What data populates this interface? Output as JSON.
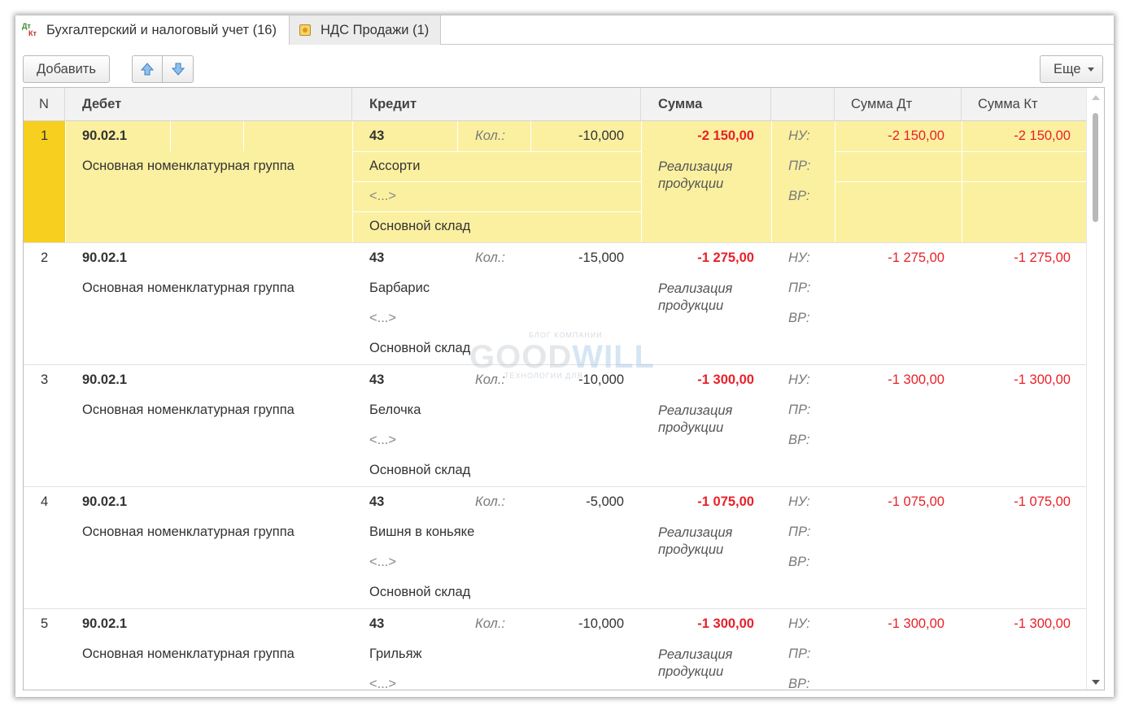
{
  "tabs": [
    {
      "label": "Бухгалтерский и налоговый учет (16)",
      "icon": "dt-kt-icon",
      "active": true
    },
    {
      "label": "НДС Продажи (1)",
      "icon": "coins-icon",
      "active": false
    }
  ],
  "tab_icon_text": {
    "dt": "Дт",
    "kt": "Кт"
  },
  "toolbar": {
    "add_label": "Добавить",
    "up_icon": "arrow-up-icon",
    "down_icon": "arrow-down-icon",
    "more_label": "Еще"
  },
  "columns": {
    "n": "N",
    "debit": "Дебет",
    "credit": "Кредит",
    "sum": "Сумма",
    "blank": "",
    "sum_dt": "Сумма Дт",
    "sum_kt": "Сумма Кт"
  },
  "labels": {
    "kol": "Кол.:",
    "nu": "НУ:",
    "pr": "ПР:",
    "vr": "ВР:"
  },
  "rows": [
    {
      "n": "1",
      "debit_account": "90.02.1",
      "debit_sub": "Основная номенклатурная группа",
      "credit_account": "43",
      "qty": "-10,000",
      "credit_sub1": "Ассорти",
      "credit_sub2": "<...>",
      "credit_sub3": "Основной склад",
      "sum": "-2 150,00",
      "content": "Реализация продукции",
      "sum_dt": "-2 150,00",
      "sum_kt": "-2 150,00",
      "selected": true
    },
    {
      "n": "2",
      "debit_account": "90.02.1",
      "debit_sub": "Основная номенклатурная группа",
      "credit_account": "43",
      "qty": "-15,000",
      "credit_sub1": "Барбарис",
      "credit_sub2": "<...>",
      "credit_sub3": "Основной склад",
      "sum": "-1 275,00",
      "content": "Реализация продукции",
      "sum_dt": "-1 275,00",
      "sum_kt": "-1 275,00",
      "selected": false
    },
    {
      "n": "3",
      "debit_account": "90.02.1",
      "debit_sub": "Основная номенклатурная группа",
      "credit_account": "43",
      "qty": "-10,000",
      "credit_sub1": "Белочка",
      "credit_sub2": "<...>",
      "credit_sub3": "Основной склад",
      "sum": "-1 300,00",
      "content": "Реализация продукции",
      "sum_dt": "-1 300,00",
      "sum_kt": "-1 300,00",
      "selected": false
    },
    {
      "n": "4",
      "debit_account": "90.02.1",
      "debit_sub": "Основная номенклатурная группа",
      "credit_account": "43",
      "qty": "-5,000",
      "credit_sub1": "Вишня в коньяке",
      "credit_sub2": "<...>",
      "credit_sub3": "Основной склад",
      "sum": "-1 075,00",
      "content": "Реализация продукции",
      "sum_dt": "-1 075,00",
      "sum_kt": "-1 075,00",
      "selected": false
    },
    {
      "n": "5",
      "debit_account": "90.02.1",
      "debit_sub": "Основная номенклатурная группа",
      "credit_account": "43",
      "qty": "-10,000",
      "credit_sub1": "Грильяж",
      "credit_sub2": "<...>",
      "credit_sub3": "",
      "sum": "-1 300,00",
      "content": "Реализация продукции",
      "sum_dt": "-1 300,00",
      "sum_kt": "-1 300,00",
      "selected": false
    }
  ],
  "watermark": {
    "top": "БЛОГ КОМПАНИИ",
    "main_a": "GOOD",
    "main_b": "WILL",
    "sub": "ТЕХНОЛОГИИ ДЛЯ"
  },
  "colors": {
    "selected_row": "#fbf0a0",
    "selected_marker": "#f6cf1f",
    "negative": "#e8202a"
  }
}
